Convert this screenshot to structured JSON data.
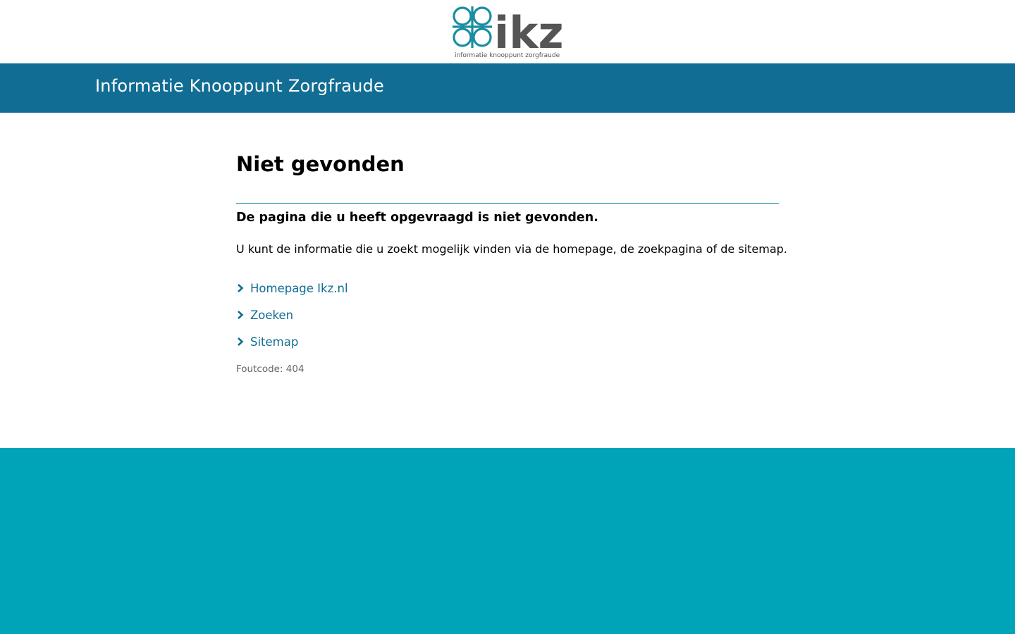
{
  "header": {
    "logo_text": "ikz",
    "logo_subtitle": "informatie knooppunt zorgfraude",
    "site_title": "Informatie Knooppunt Zorgfraude"
  },
  "main": {
    "title": "Niet gevonden",
    "lead": "De pagina die u heeft opgevraagd is niet gevonden.",
    "intro": "U kunt de informatie die u zoekt mogelijk vinden via de homepage, de zoekpagina of de sitemap.",
    "links": [
      {
        "label": "Homepage Ikz.nl",
        "icon": "chevron-right-icon"
      },
      {
        "label": "Zoeken",
        "icon": "chevron-right-icon"
      },
      {
        "label": "Sitemap",
        "icon": "chevron-right-icon"
      }
    ],
    "error_code": "Foutcode: 404"
  },
  "colors": {
    "title_bar": "#116d94",
    "footer": "#00a4b8",
    "link": "#116d94",
    "divider": "#1a8ea1",
    "logo_symbol": "#1a8ea1",
    "logo_text": "#555555"
  }
}
